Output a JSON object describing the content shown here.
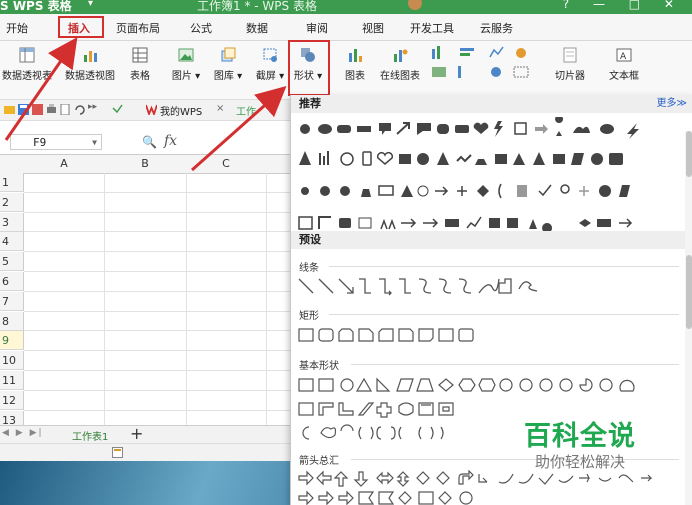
{
  "app": {
    "label": "S WPS 表格",
    "dropdown": "▾",
    "doc_title": "工作簿1 * - WPS 表格"
  },
  "menu": [
    "开始",
    "插入",
    "页面布局",
    "公式",
    "数据",
    "审阅",
    "视图",
    "开发工具",
    "云服务"
  ],
  "menu_active_index": 1,
  "ribbon": {
    "pivot_table": "数据透视表",
    "pivot_chart": "数据透视图",
    "table": "表格",
    "picture": "图片 ▾",
    "gallery": "图库 ▾",
    "screenshot": "截屏 ▾",
    "shapes": "形状 ▾",
    "chart": "图表",
    "online_chart": "在线图表",
    "slicer": "切片器",
    "textbox": "文本框"
  },
  "quickbar": {
    "mywps": "我的WPS",
    "close": "×",
    "doc_tab": "工作"
  },
  "formula_bar": {
    "name_box": "F9",
    "fx": "fx",
    "zoom_glyph": "🔍"
  },
  "sheet": {
    "columns": [
      "A",
      "B",
      "C"
    ],
    "rows": [
      "1",
      "2",
      "3",
      "4",
      "5",
      "6",
      "7",
      "8",
      "9",
      "10",
      "11",
      "12",
      "13"
    ],
    "selected_row": "9"
  },
  "sheet_tabs": {
    "nav": "◀ ▶ ▶|",
    "active": "工作表1",
    "add": "+"
  },
  "shapes_panel": {
    "recommended": "推荐",
    "more": "更多≫",
    "preset": "预设",
    "lines": "线条",
    "rectangles": "矩形",
    "basic_shapes": "基本形状",
    "block_arrows": "箭头总汇"
  },
  "watermark": {
    "title": "百科全说",
    "subtitle": "助你轻松解决"
  },
  "colors": {
    "wps_green": "#3c9b4e",
    "highlight_red": "#d32f2f",
    "link_blue": "#2962c8",
    "watermark_green": "#1fa84f"
  }
}
